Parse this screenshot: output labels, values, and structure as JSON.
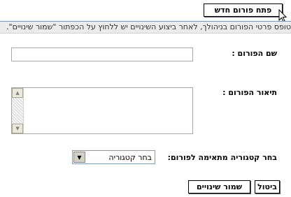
{
  "header": {
    "open_forum_label": "פתח פורום חדש"
  },
  "info_bar": {
    "text": "טופס פרטי הפורום בניהולך, לאחר ביצוע השינויים יש ללחוץ על הכפתור \"שמור שינויים\"."
  },
  "form": {
    "name_label": "שם הפורום :",
    "name_value": "",
    "description_label": "תיאור הפורום :",
    "description_value": "",
    "category_label": "בחר קטגוריה מתאימה לפורום:",
    "category_selected": "בחר קטגוריה"
  },
  "actions": {
    "cancel_label": "ביטול",
    "save_label": "שמור שינויים"
  }
}
